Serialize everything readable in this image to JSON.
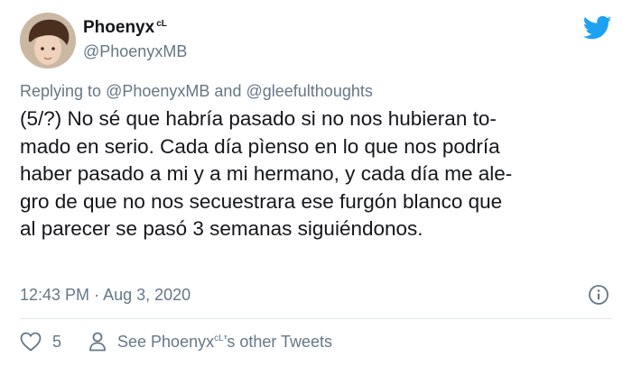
{
  "header": {
    "display_name": "Phoenyx",
    "name_superscript": "cL",
    "handle": "@PhoenyxMB"
  },
  "reply": {
    "prefix": "Replying to",
    "mention1": "@PhoenyxMB",
    "conjunction": "and",
    "mention2": "@gleefulthoughts"
  },
  "tweet": {
    "lines": [
      "(5/?) No sé que habría pasado si no nos hubieran to-",
      "mado en serio. Cada día pìenso en lo que nos podría",
      "haber pasado a mi y a mi hermano, y cada día me ale-",
      "gro de que no nos secuestrara ese furgón blanco que",
      "al parecer se pasó 3 semanas siguiéndonos."
    ]
  },
  "meta": {
    "time": "12:43 PM",
    "separator": "·",
    "date": "Aug 3, 2020"
  },
  "actions": {
    "likes": "5",
    "see_prefix": "See Phoenyx",
    "see_superscript": "cL",
    "see_suffix": "’s other Tweets"
  },
  "colors": {
    "twitter_blue": "#1da1f2",
    "secondary_text": "#657786",
    "primary_text": "#14171a",
    "divider": "#e1e8ed"
  },
  "icons": [
    "avatar",
    "twitter-bird-icon",
    "info-icon",
    "heart-icon",
    "person-icon"
  ]
}
